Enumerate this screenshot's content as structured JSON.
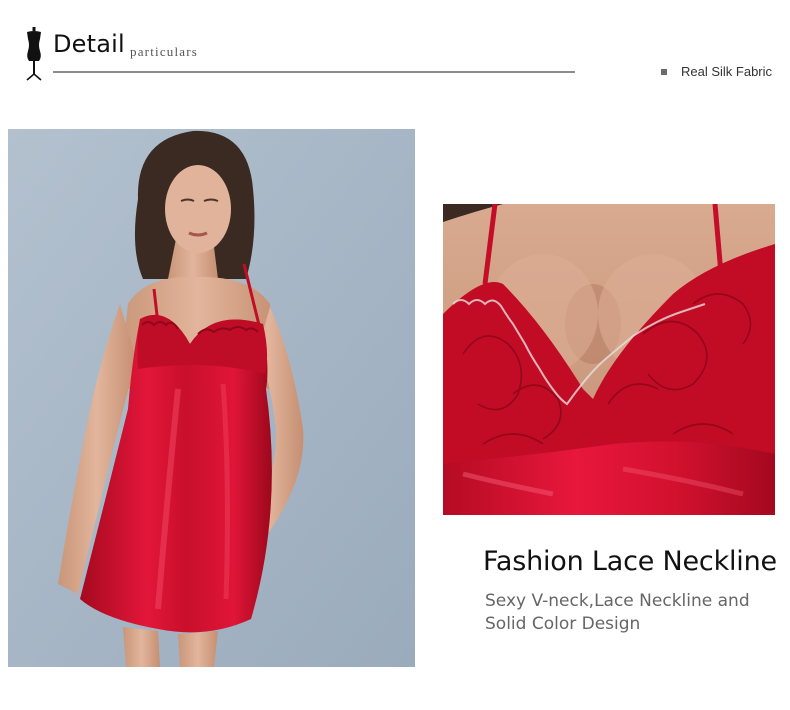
{
  "header": {
    "title": "Detail",
    "subtitle": "particulars",
    "feature_label": "Real Silk Fabric",
    "icon": "mannequin-icon"
  },
  "caption": {
    "title": "Fashion Lace Neckline",
    "description": "Sexy V-neck,Lace Neckline and Solid Color Design"
  },
  "colors": {
    "dress_red": "#d0102a",
    "lace_red": "#c20c25",
    "photo_background": "#a9b8c7",
    "skin": "#d9ab93",
    "hair": "#3a2a22",
    "rule_gray": "#8b8b8b"
  }
}
